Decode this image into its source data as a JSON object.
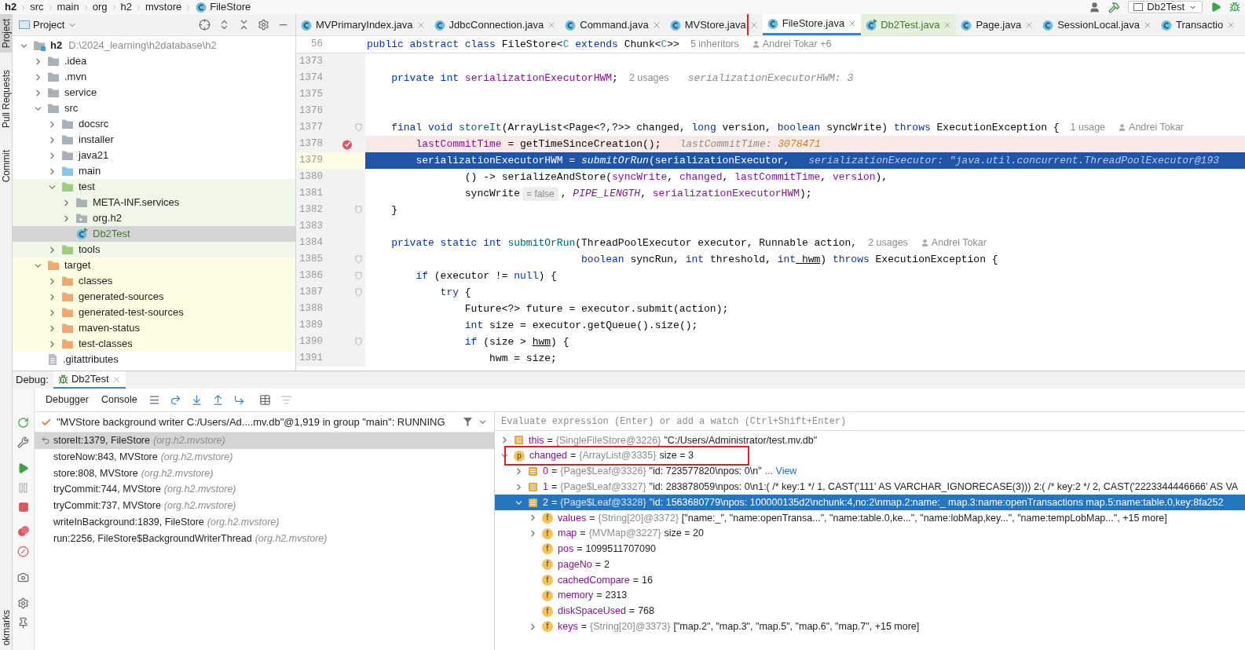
{
  "breadcrumb": [
    {
      "label": "h2",
      "kind": "module"
    },
    {
      "label": "src",
      "kind": "dir"
    },
    {
      "label": "main",
      "kind": "dir"
    },
    {
      "label": "org",
      "kind": "dir"
    },
    {
      "label": "h2",
      "kind": "dir"
    },
    {
      "label": "mvstore",
      "kind": "dir"
    },
    {
      "label": "FileStore",
      "kind": "class"
    }
  ],
  "run_config": "Db2Test",
  "stripe": {
    "items": [
      {
        "label": "Project",
        "selected": true
      },
      {
        "label": "Pull Requests",
        "selected": false
      },
      {
        "label": "Commit",
        "selected": false
      }
    ],
    "bottom": "okmarks"
  },
  "project": {
    "title": "Project",
    "tree": [
      {
        "label": "h2",
        "path": "D:\\2024_learning\\h2database\\h2",
        "kind": "module",
        "expanded": true,
        "selected": false,
        "children": [
          {
            "label": ".idea",
            "kind": "folder",
            "expanded": false,
            "selected": false
          },
          {
            "label": ".mvn",
            "kind": "folder",
            "expanded": false,
            "selected": false
          },
          {
            "label": "service",
            "kind": "folder",
            "expanded": false,
            "selected": false
          },
          {
            "label": "src",
            "kind": "folder",
            "expanded": true,
            "selected": false,
            "children": [
              {
                "label": "docsrc",
                "kind": "folder",
                "expanded": false,
                "selected": false
              },
              {
                "label": "installer",
                "kind": "folder",
                "expanded": false,
                "selected": false
              },
              {
                "label": "java21",
                "kind": "folder",
                "expanded": false,
                "selected": false
              },
              {
                "label": "main",
                "kind": "source",
                "expanded": false,
                "selected": false
              },
              {
                "label": "test",
                "kind": "test",
                "expanded": true,
                "selected": false,
                "children": [
                  {
                    "label": "META-INF.services",
                    "kind": "folder",
                    "expanded": false,
                    "selected": false
                  },
                  {
                    "label": "org.h2",
                    "kind": "package",
                    "expanded": false,
                    "selected": false
                  },
                  {
                    "label": "Db2Test",
                    "kind": "class",
                    "selected": true
                  }
                ]
              },
              {
                "label": "tools",
                "kind": "test",
                "expanded": false,
                "selected": false
              }
            ]
          },
          {
            "label": "target",
            "kind": "excluded",
            "expanded": true,
            "selected": false,
            "children": [
              {
                "label": "classes",
                "kind": "excluded",
                "expanded": false,
                "selected": false
              },
              {
                "label": "generated-sources",
                "kind": "excluded",
                "expanded": false,
                "selected": false
              },
              {
                "label": "generated-test-sources",
                "kind": "excluded",
                "expanded": false,
                "selected": false
              },
              {
                "label": "maven-status",
                "kind": "excluded",
                "expanded": false,
                "selected": false
              },
              {
                "label": "test-classes",
                "kind": "excluded",
                "expanded": false,
                "selected": false
              }
            ]
          },
          {
            "label": ".gitattributes",
            "kind": "file",
            "selected": false
          }
        ]
      }
    ]
  },
  "tabs": [
    {
      "label": "MVPrimaryIndex.java",
      "kind": "class",
      "selected": false,
      "annotated": false
    },
    {
      "label": "JdbcConnection.java",
      "kind": "class",
      "selected": false,
      "annotated": false
    },
    {
      "label": "Command.java",
      "kind": "class",
      "selected": false,
      "annotated": false
    },
    {
      "label": "MVStore.java",
      "kind": "class",
      "selected": false,
      "annotated": false
    },
    {
      "label": "FileStore.java",
      "kind": "class",
      "selected": true,
      "annotated": true
    },
    {
      "label": "Db2Test.java",
      "kind": "test",
      "selected": false,
      "annotated": false
    },
    {
      "label": "Page.java",
      "kind": "class",
      "selected": false,
      "annotated": false
    },
    {
      "label": "SessionLocal.java",
      "kind": "class",
      "selected": false,
      "annotated": false
    },
    {
      "label": "Transactio",
      "kind": "class",
      "selected": false,
      "annotated": false
    }
  ],
  "editor": {
    "sticky": {
      "number": "56",
      "segments": [
        {
          "kind": "keyword",
          "text": "public abstract class"
        },
        {
          "kind": "plain",
          "text": " FileStore<"
        },
        {
          "kind": "typeparam",
          "text": "C"
        },
        {
          "kind": "keyword",
          "text": " extends"
        },
        {
          "kind": "plain",
          "text": " Chunk<"
        },
        {
          "kind": "typeparam",
          "text": "C"
        },
        {
          "kind": "plain",
          "text": ">>"
        },
        {
          "kind": "hint",
          "text": "5 inheritors"
        },
        {
          "kind": "author",
          "text": "Andrei Tokar +6"
        }
      ]
    },
    "lines": [
      {
        "number": "1373",
        "kind": "normal",
        "fold": false
      },
      {
        "number": "1374",
        "kind": "normal",
        "fold": false,
        "segments": [
          {
            "kind": "keyword",
            "text": "    private int"
          },
          {
            "kind": "field",
            "text": " serializationExecutorHWM"
          },
          {
            "kind": "plain",
            "text": ";"
          },
          {
            "kind": "hint",
            "text": "2 usages"
          },
          {
            "kind": "debug",
            "text": "serializationExecutorHWM: 3"
          }
        ]
      },
      {
        "number": "1375",
        "kind": "normal",
        "fold": false
      },
      {
        "number": "1376",
        "kind": "normal",
        "fold": false
      },
      {
        "number": "1377",
        "kind": "normal",
        "fold": true,
        "segments": [
          {
            "kind": "keyword",
            "text": "    final void"
          },
          {
            "kind": "method",
            "text": " storeIt"
          },
          {
            "kind": "plain",
            "text": "(ArrayList<Page<?,?>> changed, "
          },
          {
            "kind": "keyword",
            "text": "long"
          },
          {
            "kind": "plain",
            "text": " version, "
          },
          {
            "kind": "keyword",
            "text": "boolean"
          },
          {
            "kind": "plain",
            "text": " syncWrite) "
          },
          {
            "kind": "keyword",
            "text": "throws"
          },
          {
            "kind": "plain",
            "text": " ExecutionException {"
          },
          {
            "kind": "hint",
            "text": "1 usage"
          },
          {
            "kind": "author",
            "text": "Andrei Tokar"
          }
        ]
      },
      {
        "number": "1378",
        "kind": "breakpoint",
        "fold": false,
        "segments": [
          {
            "kind": "field",
            "text": "        lastCommitTime"
          },
          {
            "kind": "plain",
            "text": " = getTimeSinceCreation();"
          },
          {
            "kind": "debug",
            "text": "lastCommitTime: "
          },
          {
            "kind": "number",
            "text": "3078471"
          }
        ]
      },
      {
        "number": "1379",
        "kind": "current",
        "fold": false,
        "segments": [
          {
            "kind": "plain",
            "text": "        serializationExecutorHWM = "
          },
          {
            "kind": "call",
            "text": "submitOrRun"
          },
          {
            "kind": "plain",
            "text": "(serializationExecutor,"
          },
          {
            "kind": "debug",
            "text": "serializationExecutor: \"java.util.concurrent.ThreadPoolExecutor@193"
          }
        ]
      },
      {
        "number": "1380",
        "kind": "normal",
        "fold": false,
        "segments": [
          {
            "kind": "plain",
            "text": "                () -> serializeAndStore("
          },
          {
            "kind": "field",
            "text": "syncWrite"
          },
          {
            "kind": "plain",
            "text": ", "
          },
          {
            "kind": "field",
            "text": "changed"
          },
          {
            "kind": "plain",
            "text": ", "
          },
          {
            "kind": "field",
            "text": "lastCommitTime"
          },
          {
            "kind": "plain",
            "text": ", "
          },
          {
            "kind": "field",
            "text": "version"
          },
          {
            "kind": "plain",
            "text": "),"
          }
        ]
      },
      {
        "number": "1381",
        "kind": "normal",
        "fold": false,
        "segments": [
          {
            "kind": "plain",
            "text": "                syncWrite"
          },
          {
            "kind": "inlay",
            "text": "= false"
          },
          {
            "kind": "plain",
            "text": ", "
          },
          {
            "kind": "constant",
            "text": "PIPE_LENGTH"
          },
          {
            "kind": "plain",
            "text": ", "
          },
          {
            "kind": "field",
            "text": "serializationExecutorHWM"
          },
          {
            "kind": "plain",
            "text": ");"
          }
        ]
      },
      {
        "number": "1382",
        "kind": "normal",
        "fold": true,
        "segments": [
          {
            "kind": "plain",
            "text": "    }"
          }
        ]
      },
      {
        "number": "1383",
        "kind": "normal",
        "fold": false
      },
      {
        "number": "1384",
        "kind": "normal",
        "fold": false,
        "segments": [
          {
            "kind": "keyword",
            "text": "    private static int"
          },
          {
            "kind": "method",
            "text": " submitOrRun"
          },
          {
            "kind": "plain",
            "text": "(ThreadPoolExecutor executor, Runnable action,"
          },
          {
            "kind": "hint",
            "text": "2 usages"
          },
          {
            "kind": "author",
            "text": "Andrei Tokar"
          }
        ]
      },
      {
        "number": "1385",
        "kind": "normal",
        "fold": true,
        "segments": [
          {
            "kind": "keyword",
            "text": "                                   boolean"
          },
          {
            "kind": "plain",
            "text": " syncRun, "
          },
          {
            "kind": "keyword",
            "text": "int"
          },
          {
            "kind": "plain",
            "text": " threshold, "
          },
          {
            "kind": "keyword",
            "text": "int"
          },
          {
            "kind": "param",
            "text": " hwm"
          },
          {
            "kind": "plain",
            "text": ") "
          },
          {
            "kind": "keyword",
            "text": "throws"
          },
          {
            "kind": "plain",
            "text": " ExecutionException {"
          }
        ]
      },
      {
        "number": "1386",
        "kind": "normal",
        "fold": true,
        "segments": [
          {
            "kind": "keyword",
            "text": "        if"
          },
          {
            "kind": "plain",
            "text": " (executor != "
          },
          {
            "kind": "keyword",
            "text": "null"
          },
          {
            "kind": "plain",
            "text": ") {"
          }
        ]
      },
      {
        "number": "1387",
        "kind": "normal",
        "fold": true,
        "segments": [
          {
            "kind": "keyword",
            "text": "            try"
          },
          {
            "kind": "plain",
            "text": " {"
          }
        ]
      },
      {
        "number": "1388",
        "kind": "normal",
        "fold": false,
        "segments": [
          {
            "kind": "plain",
            "text": "                Future<?> future = executor.submit(action);"
          }
        ]
      },
      {
        "number": "1389",
        "kind": "normal",
        "fold": false,
        "segments": [
          {
            "kind": "keyword",
            "text": "                int"
          },
          {
            "kind": "plain",
            "text": " size = executor.getQueue().size();"
          }
        ]
      },
      {
        "number": "1390",
        "kind": "normal",
        "fold": true,
        "segments": [
          {
            "kind": "keyword",
            "text": "                if"
          },
          {
            "kind": "plain",
            "text": " (size > "
          },
          {
            "kind": "param",
            "text": "hwm"
          },
          {
            "kind": "plain",
            "text": ") {"
          }
        ]
      },
      {
        "number": "1391",
        "kind": "normal",
        "fold": false,
        "segments": [
          {
            "kind": "plain",
            "text": "                    hwm = size;"
          }
        ]
      }
    ]
  },
  "debug": {
    "title": "Debug:",
    "tab": "Db2Test",
    "view_tabs": [
      "Debugger",
      "Console"
    ],
    "thread": "\"MVStore background writer C:/Users/Ad....mv.db\"@1,919 in group \"main\": RUNNING",
    "frames": [
      {
        "method": "storeIt:1379, FileStore",
        "package": "(org.h2.mvstore)",
        "selected": true
      },
      {
        "method": "storeNow:843, MVStore",
        "package": "(org.h2.mvstore)",
        "selected": false
      },
      {
        "method": "store:808, MVStore",
        "package": "(org.h2.mvstore)",
        "selected": false
      },
      {
        "method": "tryCommit:744, MVStore",
        "package": "(org.h2.mvstore)",
        "selected": false
      },
      {
        "method": "tryCommit:737, MVStore",
        "package": "(org.h2.mvstore)",
        "selected": false
      },
      {
        "method": "writeInBackground:1839, FileStore",
        "package": "(org.h2.mvstore)",
        "selected": false
      },
      {
        "method": "run:2256, FileStore$BackgroundWriterThread",
        "package": "(org.h2.mvstore)",
        "selected": false
      }
    ],
    "evaluate_placeholder": "Evaluate expression (Enter) or add a watch (Ctrl+Shift+Enter)",
    "variables": [
      {
        "name": "this",
        "op": "=",
        "type": "{SingleFileStore@3226}",
        "value": "\"C:/Users/Administrator/test.mv.db\"",
        "kind": "object",
        "expanded": false,
        "selected": false,
        "annotated": false
      },
      {
        "name": "changed",
        "op": "=",
        "type": "{ArrayList@3335}",
        "value": "size = 3",
        "kind": "badge",
        "badge": "p",
        "expanded": true,
        "selected": false,
        "annotated": true,
        "children": [
          {
            "name": "0",
            "op": "=",
            "type": "{Page$Leaf@3326}",
            "value": "\"id: 723577820\\npos: 0\\n\"",
            "link": "... View",
            "kind": "object",
            "expanded": false,
            "selected": false,
            "annotated": false
          },
          {
            "name": "1",
            "op": "=",
            "type": "{Page$Leaf@3327}",
            "value": "\"id: 283878059\\npos: 0\\n1:( /* key:1 */ 1, CAST('111' AS VARCHAR_IGNORECASE(3))) 2:( /* key:2 */ 2, CAST('2223344446666' AS VA",
            "kind": "object",
            "expanded": false,
            "selected": false,
            "annotated": false
          },
          {
            "name": "2",
            "op": "=",
            "type": "{Page$Leaf@3328}",
            "value": "\"id: 1563680779\\npos: 100000135d2\\nchunk:4,no:2\\nmap.2:name:_ map.3:name:openTransactions map.5:name:table.0,key:8fa252",
            "kind": "object",
            "expanded": true,
            "selected": true,
            "annotated": false,
            "children": [
              {
                "name": "values",
                "op": "=",
                "type": "{String[20]@3372}",
                "value": "[\"name:_\", \"name:openTransa...\", \"name:table.0,ke...\", \"name:lobMap,key...\", \"name:tempLobMap...\", +15 more]",
                "kind": "badge",
                "badge": "f",
                "expanded": false,
                "selected": false,
                "annotated": false
              },
              {
                "name": "map",
                "op": "=",
                "type": "{MVMap@3227}",
                "value": "size = 20",
                "kind": "badge",
                "badge": "f",
                "expanded": false,
                "selected": false,
                "annotated": false
              },
              {
                "name": "pos",
                "op": "=",
                "value": "1099511707090",
                "kind": "badge",
                "badge": "f",
                "selected": false,
                "annotated": false
              },
              {
                "name": "pageNo",
                "op": "=",
                "value": "2",
                "kind": "badge",
                "badge": "f",
                "selected": false,
                "annotated": false
              },
              {
                "name": "cachedCompare",
                "op": "=",
                "value": "16",
                "kind": "badge",
                "badge": "f",
                "selected": false,
                "annotated": false
              },
              {
                "name": "memory",
                "op": "=",
                "value": "2313",
                "kind": "badge",
                "badge": "f",
                "selected": false,
                "annotated": false
              },
              {
                "name": "diskSpaceUsed",
                "op": "=",
                "value": "768",
                "kind": "badge",
                "badge": "f",
                "selected": false,
                "annotated": false
              },
              {
                "name": "keys",
                "op": "=",
                "type": "{String[20]@3373}",
                "value": "[\"map.2\", \"map.3\", \"map.5\", \"map.6\", \"map.7\", +15 more]",
                "kind": "badge",
                "badge": "f",
                "expanded": false,
                "selected": false,
                "annotated": false
              }
            ]
          }
        ]
      }
    ]
  }
}
